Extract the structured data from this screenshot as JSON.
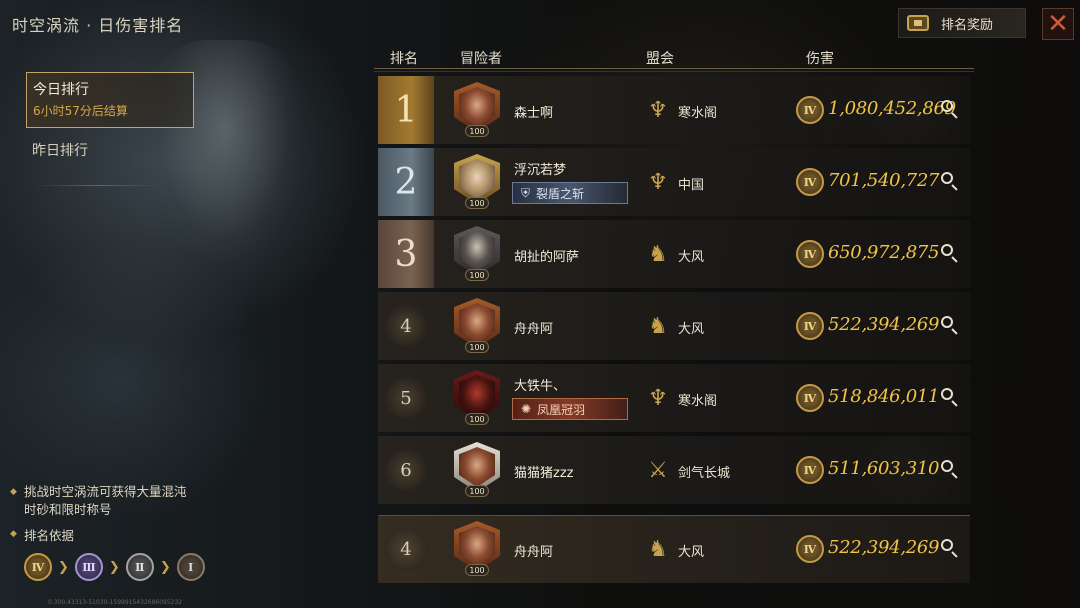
{
  "header": {
    "title": "时空涡流 · 日伤害排名",
    "reward_label": "排名奖励",
    "close_glyph": "✕"
  },
  "tabs": {
    "today_label": "今日排行",
    "today_countdown": "6小时57分后结算",
    "yesterday_label": "昨日排行"
  },
  "info": {
    "tip_line1": "挑战时空涡流可获得大量混沌",
    "tip_line2": "时砂和限时称号",
    "basis_label": "排名依据",
    "tiers": [
      "Ⅳ",
      "Ⅲ",
      "Ⅱ",
      "Ⅰ"
    ],
    "version": "0.300.43313-51030-1599915432686095232"
  },
  "columns": {
    "rank": "排名",
    "adventurer": "冒险者",
    "guild": "盟会",
    "damage": "伤害"
  },
  "rows": [
    {
      "rank": "1",
      "level": "100",
      "name": "森士啊",
      "title": "",
      "guild": "寒水阁",
      "guild_icon": "dragon-emblem",
      "tier": "Ⅳ",
      "damage": "1,080,452,869"
    },
    {
      "rank": "2",
      "level": "100",
      "name": "浮沉若梦",
      "title": "裂盾之斩",
      "guild": "中国",
      "guild_icon": "dragon-emblem",
      "tier": "Ⅳ",
      "damage": "701,540,727"
    },
    {
      "rank": "3",
      "level": "100",
      "name": "胡扯的阿萨",
      "title": "",
      "guild": "大风",
      "guild_icon": "wolf-emblem",
      "tier": "Ⅳ",
      "damage": "650,972,875"
    },
    {
      "rank": "4",
      "level": "100",
      "name": "舟舟阿",
      "title": "",
      "guild": "大风",
      "guild_icon": "wolf-emblem",
      "tier": "Ⅳ",
      "damage": "522,394,269"
    },
    {
      "rank": "5",
      "level": "100",
      "name": "大铁牛、",
      "title": "凤凰冠羽",
      "guild": "寒水阁",
      "guild_icon": "dragon-emblem",
      "tier": "Ⅳ",
      "damage": "518,846,011"
    },
    {
      "rank": "6",
      "level": "100",
      "name": "猫猫猪zzz",
      "title": "",
      "guild": "剑气长城",
      "guild_icon": "sword-emblem",
      "tier": "Ⅳ",
      "damage": "511,603,310"
    }
  ],
  "my_row": {
    "rank": "4",
    "level": "100",
    "name": "舟舟阿",
    "guild": "大风",
    "guild_icon": "wolf-emblem",
    "tier": "Ⅳ",
    "damage": "522,394,269"
  },
  "colors": {
    "gold": "#f2c447",
    "accent": "#c9a24e"
  }
}
